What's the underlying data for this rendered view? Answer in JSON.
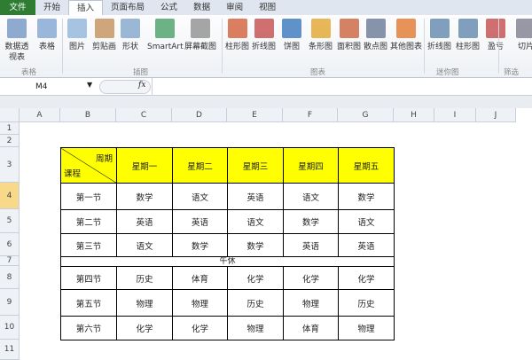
{
  "tabs": [
    "文件",
    "开始",
    "插入",
    "页面布局",
    "公式",
    "数据",
    "审阅",
    "视图"
  ],
  "active_tab": "插入",
  "ribbon": {
    "groups": [
      {
        "label": "表格"
      },
      {
        "label": "插图"
      },
      {
        "label": "图表"
      },
      {
        "label": "迷你图"
      },
      {
        "label": "筛选"
      }
    ],
    "buttons": [
      {
        "label": "数据透视表",
        "icon": "pivot-table-icon"
      },
      {
        "label": "表格",
        "icon": "table-icon"
      },
      {
        "label": "图片",
        "icon": "picture-icon"
      },
      {
        "label": "剪贴画",
        "icon": "clipart-icon"
      },
      {
        "label": "形状",
        "icon": "shapes-icon"
      },
      {
        "label": "SmartArt",
        "icon": "smartart-icon"
      },
      {
        "label": "屏幕截图",
        "icon": "screenshot-icon"
      },
      {
        "label": "柱形图",
        "icon": "column-chart-icon"
      },
      {
        "label": "折线图",
        "icon": "line-chart-icon"
      },
      {
        "label": "饼图",
        "icon": "pie-chart-icon"
      },
      {
        "label": "条形图",
        "icon": "bar-chart-icon"
      },
      {
        "label": "面积图",
        "icon": "area-chart-icon"
      },
      {
        "label": "散点图",
        "icon": "scatter-chart-icon"
      },
      {
        "label": "其他图表",
        "icon": "other-charts-icon"
      },
      {
        "label": "折线图",
        "icon": "sparkline-line-icon"
      },
      {
        "label": "柱形图",
        "icon": "sparkline-column-icon"
      },
      {
        "label": "盈亏",
        "icon": "sparkline-winloss-icon"
      },
      {
        "label": "切片",
        "icon": "slicer-icon"
      }
    ]
  },
  "formula_bar": {
    "name_box": "M4",
    "fx": "fx",
    "value": ""
  },
  "columns": [
    "A",
    "B",
    "C",
    "D",
    "E",
    "F",
    "G",
    "H",
    "I",
    "J"
  ],
  "rows": [
    "1",
    "2",
    "3",
    "4",
    "5",
    "6",
    "7",
    "8",
    "9",
    "10",
    "11"
  ],
  "selected_row": "4",
  "schedule": {
    "corner_top": "周期",
    "corner_bottom": "课程",
    "days": [
      "星期一",
      "星期二",
      "星期三",
      "星期四",
      "星期五"
    ],
    "periods": [
      {
        "name": "第一节",
        "subjects": [
          "数学",
          "语文",
          "英语",
          "语文",
          "数学"
        ]
      },
      {
        "name": "第二节",
        "subjects": [
          "英语",
          "英语",
          "语文",
          "数学",
          "语文"
        ]
      },
      {
        "name": "第三节",
        "subjects": [
          "语文",
          "数学",
          "数学",
          "英语",
          "英语"
        ]
      },
      {
        "name": "第四节",
        "subjects": [
          "历史",
          "体育",
          "化学",
          "化学",
          "化学"
        ]
      },
      {
        "name": "第五节",
        "subjects": [
          "物理",
          "物理",
          "历史",
          "物理",
          "历史"
        ]
      },
      {
        "name": "第六节",
        "subjects": [
          "化学",
          "化学",
          "物理",
          "体育",
          "物理"
        ]
      }
    ],
    "break_label": "午休"
  },
  "colors": {
    "header_fill": "#ffff00",
    "file_tab": "#2e7d32"
  }
}
